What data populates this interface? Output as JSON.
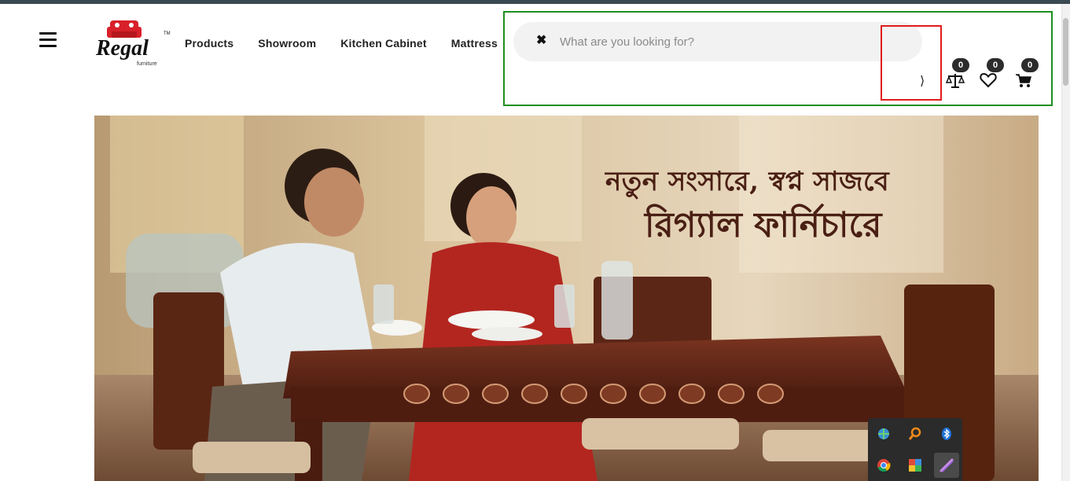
{
  "brand": {
    "name": "Regal",
    "tagline": "furniture",
    "trademark": "TM"
  },
  "nav": {
    "items": [
      {
        "label": "Products"
      },
      {
        "label": "Showroom"
      },
      {
        "label": "Kitchen Cabinet"
      },
      {
        "label": "Mattress"
      }
    ]
  },
  "search": {
    "placeholder": "What are you looking for?",
    "value": ""
  },
  "header_icons": {
    "compare": {
      "icon": "scale-icon",
      "count": "0"
    },
    "wishlist": {
      "icon": "heart-icon",
      "count": "0"
    },
    "cart": {
      "icon": "cart-icon",
      "count": "0"
    }
  },
  "banner": {
    "line1": "নতুন সংসারে, স্বপ্ন সাজবে",
    "line2": "রিগ্যাল ফার্নিচারে"
  },
  "tray": {
    "icons": [
      "network-icon",
      "search-icon",
      "bluetooth-icon",
      "chrome-icon",
      "app-icon",
      "pen-icon"
    ]
  },
  "colors": {
    "brand_red": "#d8202a",
    "highlight_green": "#1e8f1e",
    "highlight_red": "#e11b1b",
    "banner_text": "#4a1f14"
  }
}
